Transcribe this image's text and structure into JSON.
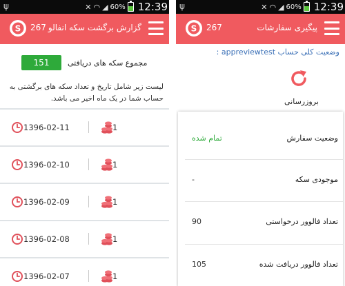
{
  "status_bar": {
    "battery": "60%",
    "time": "12:39"
  },
  "left_screen": {
    "header": {
      "title": "گزارش برگشت سکه انفالو",
      "coin_count": "267"
    },
    "total": {
      "label": "مجموع سکه های دریافتی",
      "value": "151"
    },
    "description": "لیست زیر شامل تاریخ و تعداد سکه های برگشتی به حساب شما در یک ماه اخیر می باشد.",
    "rows": [
      {
        "date": "1396-02-11",
        "coins": "1"
      },
      {
        "date": "1396-02-10",
        "coins": "1"
      },
      {
        "date": "1396-02-09",
        "coins": "1"
      },
      {
        "date": "1396-02-08",
        "coins": "1"
      },
      {
        "date": "1396-02-07",
        "coins": "1"
      }
    ]
  },
  "right_screen": {
    "header": {
      "title": "پیگیری سفارشات",
      "coin_count": "267"
    },
    "account_status": "وضعیت کلی حساب appreviewtest :",
    "refresh_label": "بروزرسانی",
    "info": [
      {
        "label": "وضعیت سفارش",
        "value": "تمام شده"
      },
      {
        "label": "موجودی سکه",
        "value": "-"
      },
      {
        "label": "تعداد فالوور درخواستی",
        "value": "90"
      },
      {
        "label": "تعداد فالوور دریافت شده",
        "value": "105"
      }
    ]
  },
  "colors": {
    "accent": "#f05a5f",
    "success": "#2eaa3a",
    "link": "#3a6fb6"
  }
}
